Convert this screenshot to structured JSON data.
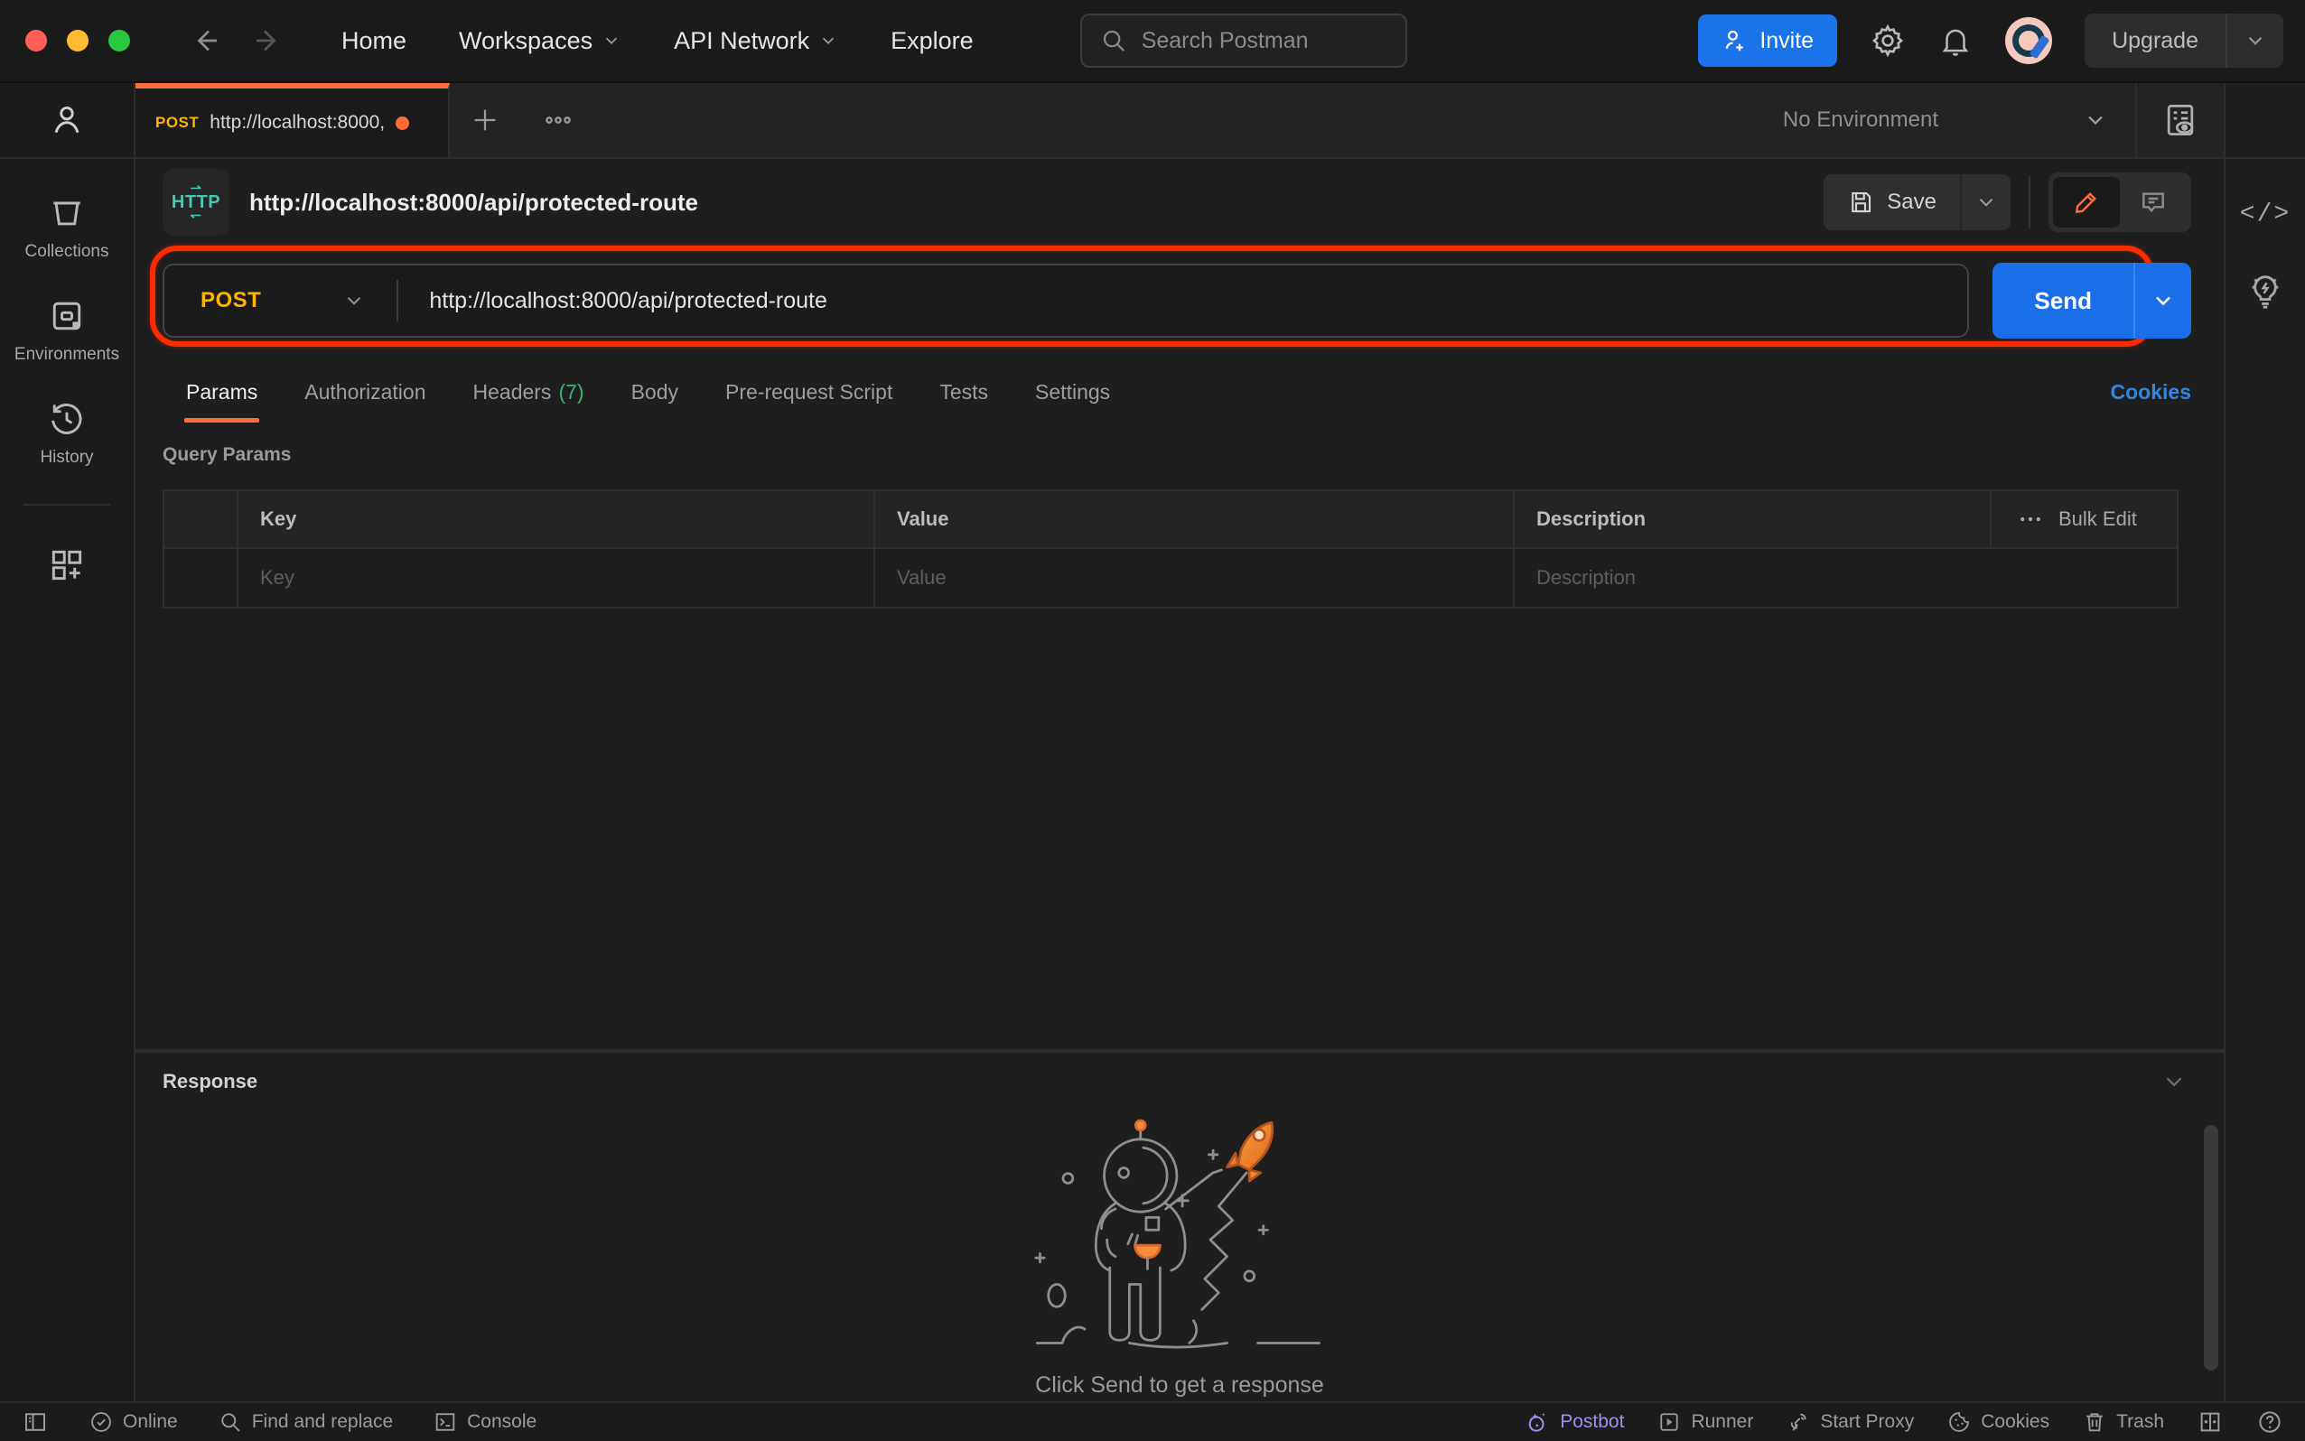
{
  "topbar": {
    "nav_home": "Home",
    "nav_workspaces": "Workspaces",
    "nav_api_network": "API Network",
    "nav_explore": "Explore",
    "search_placeholder": "Search Postman",
    "invite_label": "Invite",
    "upgrade_label": "Upgrade"
  },
  "sidebar": {
    "collections_label": "Collections",
    "environments_label": "Environments",
    "history_label": "History"
  },
  "tabstrip": {
    "tab_method": "POST",
    "tab_title": "http://localhost:8000,",
    "environment_selected": "No Environment"
  },
  "request": {
    "protocol_badge": "HTTP",
    "title": "http://localhost:8000/api/protected-route",
    "save_label": "Save",
    "method": "POST",
    "url": "http://localhost:8000/api/protected-route",
    "send_label": "Send",
    "tabs": [
      {
        "label": "Params"
      },
      {
        "label": "Authorization"
      },
      {
        "label": "Headers",
        "badge": "(7)"
      },
      {
        "label": "Body"
      },
      {
        "label": "Pre-request Script"
      },
      {
        "label": "Tests"
      },
      {
        "label": "Settings"
      }
    ],
    "cookies_link": "Cookies",
    "query_params": {
      "section_title": "Query Params",
      "col_key": "Key",
      "col_value": "Value",
      "col_description": "Description",
      "bulk_edit_label": "Bulk Edit",
      "placeholder_key": "Key",
      "placeholder_value": "Value",
      "placeholder_description": "Description"
    }
  },
  "response": {
    "title": "Response",
    "empty_message": "Click Send to get a response"
  },
  "statusbar": {
    "online_label": "Online",
    "find_replace_label": "Find and replace",
    "console_label": "Console",
    "postbot_label": "Postbot",
    "runner_label": "Runner",
    "start_proxy_label": "Start Proxy",
    "cookies_label": "Cookies",
    "trash_label": "Trash"
  },
  "colors": {
    "accent_orange": "#ff6c37",
    "method_post_yellow": "#ffb400",
    "send_button_blue": "#1a6fe8",
    "link_blue": "#3186e2",
    "headers_badge_green": "#36b374",
    "annotation_red": "#ff2b00",
    "postbot_purple": "#9f92ee",
    "http_badge_teal": "#49c5b6"
  }
}
